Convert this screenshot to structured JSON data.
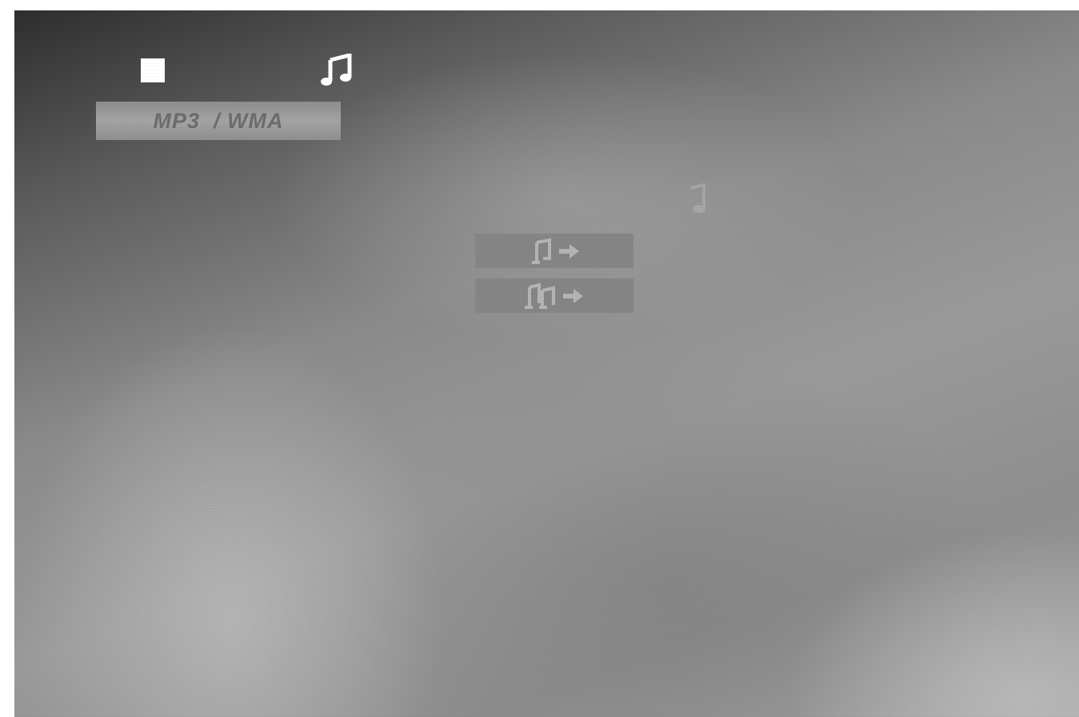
{
  "screen": {
    "mode_label": "MP3  / WMA",
    "status_icon": "stop-icon",
    "media_icon": "music-note-icon"
  },
  "menu": {
    "items": [
      {
        "icon": "single-note-icon",
        "action_icon": "right-arrow-icon"
      },
      {
        "icon": "double-note-icon",
        "action_icon": "right-arrow-icon"
      }
    ]
  },
  "colors": {
    "icon_white": "#ffffff",
    "button_gray": "#858585",
    "label_text": "#6c6c6c"
  }
}
